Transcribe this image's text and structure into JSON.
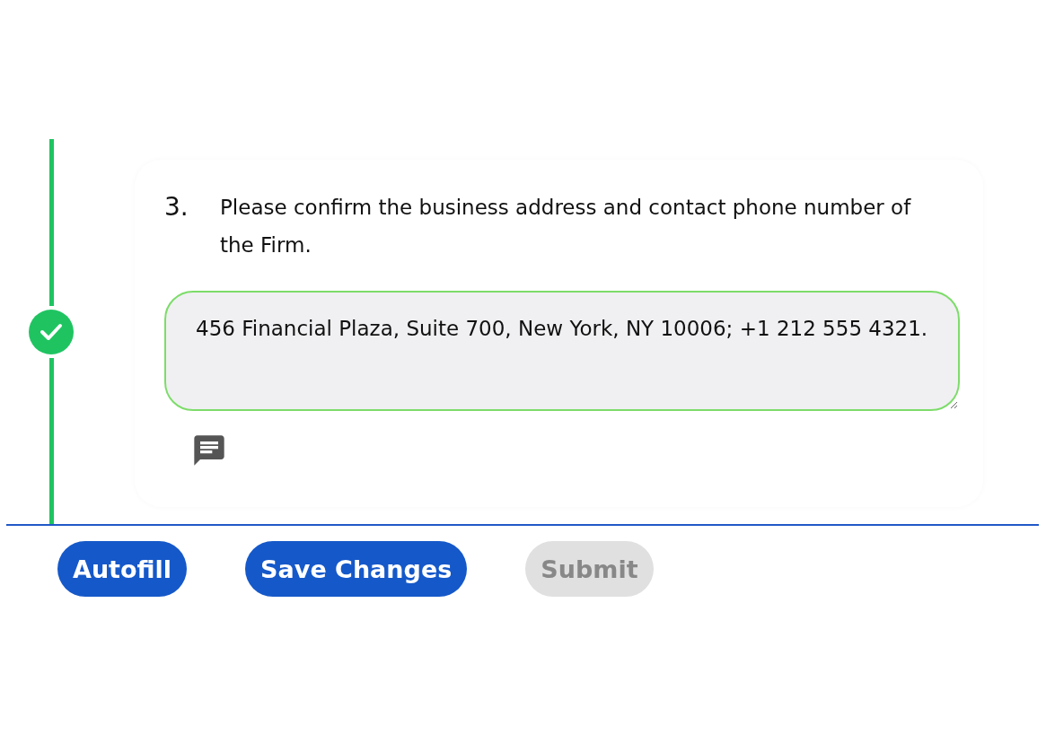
{
  "question": {
    "number": "3.",
    "text": "Please confirm the business address and contact phone number of the Firm.",
    "completed": true,
    "answer": "456 Financial Plaza, Suite 700, New York, NY 10006; +1 212 555 4321."
  },
  "buttons": [
    {
      "label": "Autofill",
      "disabled": false
    },
    {
      "label": "Save Changes",
      "disabled": false
    },
    {
      "label": "Submit",
      "disabled": true
    }
  ]
}
